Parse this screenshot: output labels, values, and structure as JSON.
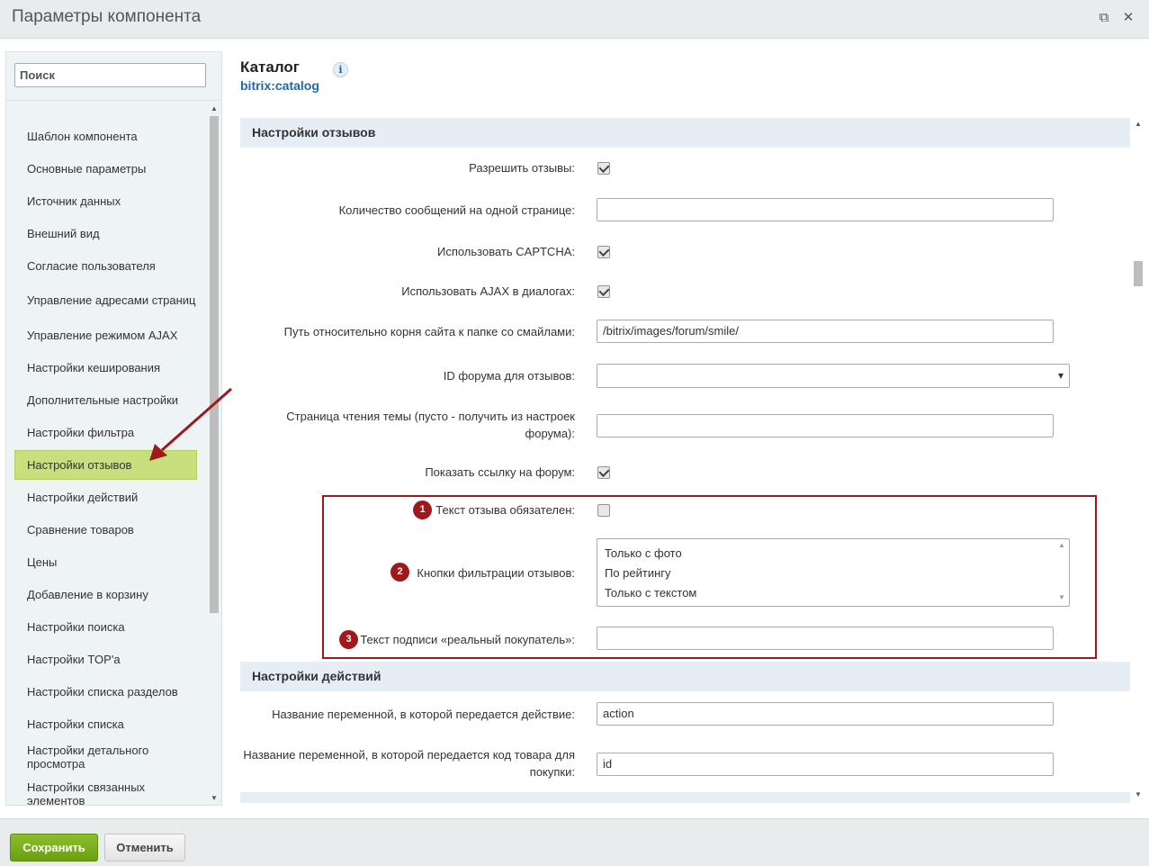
{
  "window": {
    "title": "Параметры компонента",
    "restore_glyph": "⧉",
    "close_glyph": "✕"
  },
  "search": {
    "placeholder": "Поиск",
    "value": ""
  },
  "sidebar": {
    "items": [
      {
        "label": "Шаблон компонента"
      },
      {
        "label": "Основные параметры"
      },
      {
        "label": "Источник данных"
      },
      {
        "label": "Внешний вид"
      },
      {
        "label": "Согласие пользователя"
      },
      {
        "label": "Управление адресами страниц"
      },
      {
        "label": "Управление режимом AJAX"
      },
      {
        "label": "Настройки кеширования"
      },
      {
        "label": "Дополнительные настройки"
      },
      {
        "label": "Настройки фильтра"
      },
      {
        "label": "Настройки отзывов",
        "active": true
      },
      {
        "label": "Настройки действий"
      },
      {
        "label": "Сравнение товаров"
      },
      {
        "label": "Цены"
      },
      {
        "label": "Добавление в корзину"
      },
      {
        "label": "Настройки поиска"
      },
      {
        "label": "Настройки TOP'а"
      },
      {
        "label": "Настройки списка разделов"
      },
      {
        "label": "Настройки списка"
      },
      {
        "label": "Настройки детального просмотра"
      },
      {
        "label": "Настройки связанных элементов"
      }
    ]
  },
  "component": {
    "name": "Каталог",
    "code": "bitrix:catalog",
    "info_glyph": "i"
  },
  "reviews_section": {
    "title": "Настройки отзывов",
    "allow_reviews": {
      "label": "Разрешить отзывы:",
      "checked": true
    },
    "messages_per_page": {
      "label": "Количество сообщений на одной странице:",
      "value": ""
    },
    "use_captcha": {
      "label": "Использовать CAPTCHA:",
      "checked": true
    },
    "use_ajax": {
      "label": "Использовать AJAX в диалогах:",
      "checked": true
    },
    "smiles_path": {
      "label": "Путь относительно корня сайта к папке со смайлами:",
      "value": "/bitrix/images/forum/smile/"
    },
    "forum_id": {
      "label": "ID форума для отзывов:",
      "value": ""
    },
    "topic_page": {
      "label": "Страница чтения темы (пусто - получить из настроек форума):",
      "value": ""
    },
    "show_forum_link": {
      "label": "Показать ссылку на форум:",
      "checked": true
    },
    "text_required": {
      "label": "Текст отзыва обязателен:",
      "checked": false,
      "badge": "1"
    },
    "filter_buttons": {
      "label": "Кнопки фильтрации отзывов:",
      "badge": "2",
      "options": [
        "Только с фото",
        "По рейтингу",
        "Только с текстом"
      ]
    },
    "real_buyer_caption": {
      "label": "Текст подписи «реальный покупатель»:",
      "value": "",
      "badge": "3"
    }
  },
  "actions_section": {
    "title": "Настройки действий",
    "action_var": {
      "label": "Название переменной, в которой передается действие:",
      "value": "action"
    },
    "product_id_var": {
      "label": "Название переменной, в которой передается код товара для покупки:",
      "value": "id"
    }
  },
  "footer": {
    "save_label": "Сохранить",
    "cancel_label": "Отменить"
  },
  "colors": {
    "accent_blue": "#2067b0",
    "active_item": "#c8df7d",
    "annotation_red": "#a1181c",
    "save_green": "#7bb221"
  }
}
